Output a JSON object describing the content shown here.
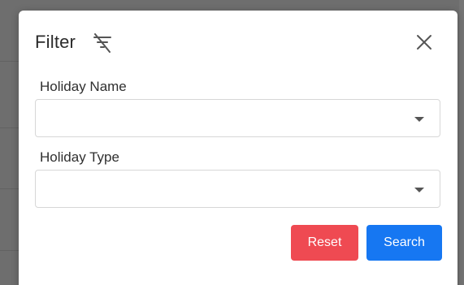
{
  "modal": {
    "title": "Filter",
    "title_icon": "filter-off-icon",
    "close_icon": "close-icon"
  },
  "fields": [
    {
      "label": "Holiday Name",
      "value": "",
      "icon": "chevron-down-icon"
    },
    {
      "label": "Holiday Type",
      "value": "",
      "icon": "chevron-down-icon"
    }
  ],
  "actions": {
    "reset_label": "Reset",
    "search_label": "Search"
  },
  "colors": {
    "reset": "#ef4a52",
    "search": "#1677f2",
    "backdrop": "#6e6e6e"
  }
}
